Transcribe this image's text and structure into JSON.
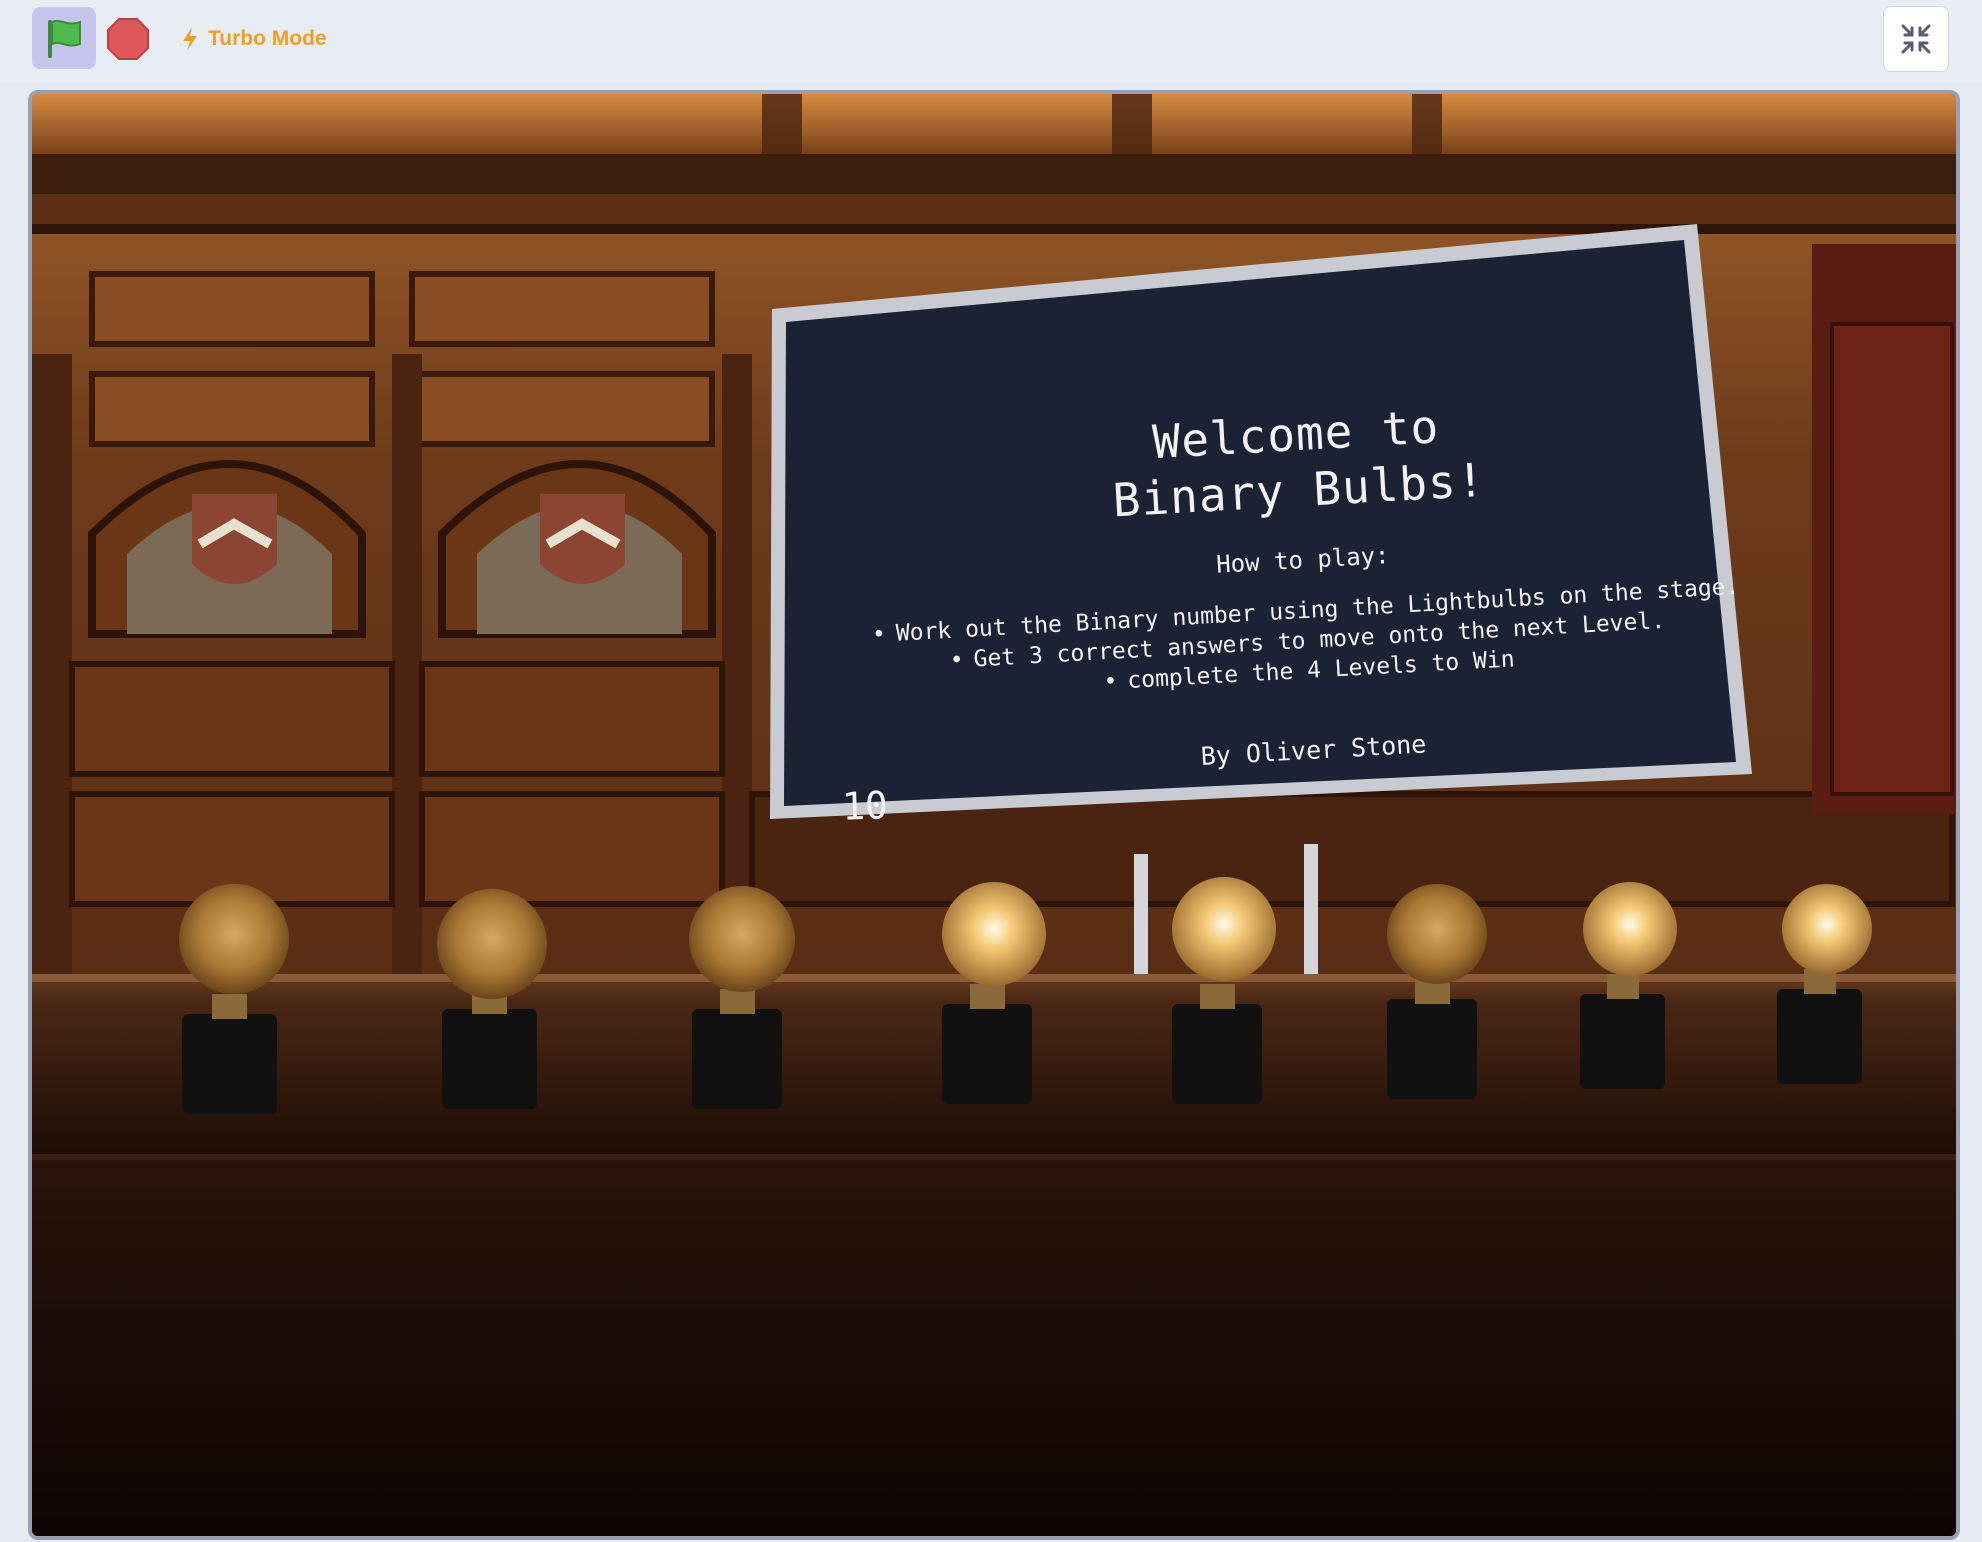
{
  "toolbar": {
    "green_flag_icon": "green-flag-icon",
    "stop_icon": "stop-sign-icon",
    "turbo_label": "Turbo Mode",
    "turbo_icon": "lightning-icon",
    "fullscreen_exit_icon": "exit-fullscreen-icon"
  },
  "colors": {
    "toolbar_bg": "#e8edf4",
    "flag_button_bg": "#c6c5eb",
    "flag_green": "#4cbb4e",
    "stop_red": "#e0575a",
    "turbo_orange": "#f29e26",
    "sign_bg": "#1b2234",
    "sign_border": "#c9cbd2"
  },
  "stage": {
    "sign": {
      "title_line1": "Welcome to",
      "title_line2": "Binary Bulbs!",
      "how_to": "How to play:",
      "bullets": [
        "Work out the Binary number using the Lightbulbs on the stage.",
        "Get 3 correct answers to move onto the next Level.",
        "complete the 4 Levels to Win"
      ],
      "author": "By Oliver Stone"
    },
    "counter": "10",
    "bulbs": [
      {
        "lit": false
      },
      {
        "lit": false
      },
      {
        "lit": false
      },
      {
        "lit": true
      },
      {
        "lit": true
      },
      {
        "lit": false
      },
      {
        "lit": true
      },
      {
        "lit": true
      }
    ]
  }
}
